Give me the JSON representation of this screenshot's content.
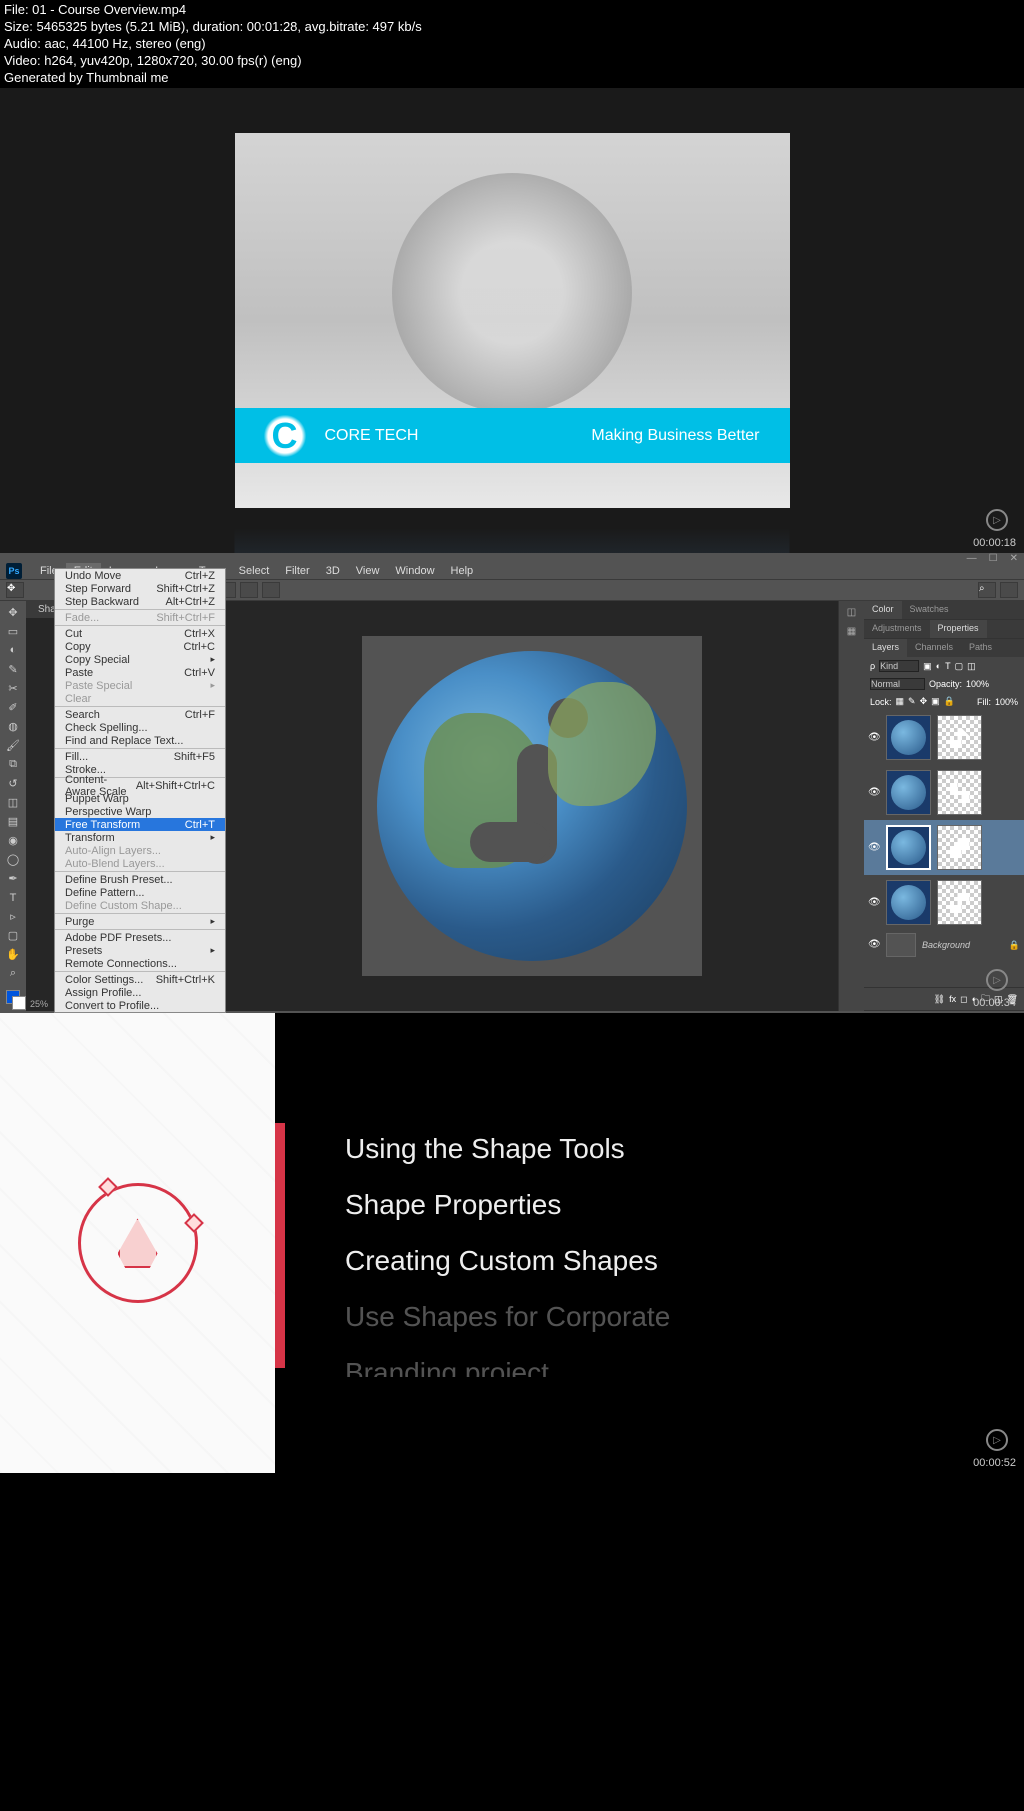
{
  "metadata": {
    "file": "File: 01 - Course Overview.mp4",
    "size": "Size: 5465325 bytes (5.21 MiB), duration: 00:01:28, avg.bitrate: 497 kb/s",
    "audio": "Audio: aac, 44100 Hz, stereo (eng)",
    "video": "Video: h264, yuv420p, 1280x720, 30.00 fps(r) (eng)",
    "generated": "Generated by Thumbnail me"
  },
  "frame1": {
    "banner_brand": "CORE TECH",
    "banner_tagline": "Making Business Better",
    "timestamp": "00:00:18"
  },
  "frame2": {
    "timestamp": "00:00:34",
    "ps_logo": "Ps",
    "window_controls": {
      "min": "—",
      "max": "☐",
      "close": "✕"
    },
    "menubar": [
      "File",
      "Edit",
      "Image",
      "Layer",
      "Type",
      "Select",
      "Filter",
      "3D",
      "View",
      "Window",
      "Help"
    ],
    "tab_label": "Shap...",
    "edit_menu": [
      {
        "label": "Undo Move",
        "shortcut": "Ctrl+Z",
        "sep": false
      },
      {
        "label": "Step Forward",
        "shortcut": "Shift+Ctrl+Z",
        "sep": false
      },
      {
        "label": "Step Backward",
        "shortcut": "Alt+Ctrl+Z",
        "sep": true
      },
      {
        "label": "Fade...",
        "shortcut": "Shift+Ctrl+F",
        "disabled": true,
        "sep": true
      },
      {
        "label": "Cut",
        "shortcut": "Ctrl+X",
        "sep": false
      },
      {
        "label": "Copy",
        "shortcut": "Ctrl+C",
        "sep": false
      },
      {
        "label": "Copy Special",
        "shortcut": "",
        "sub": true,
        "sep": false
      },
      {
        "label": "Paste",
        "shortcut": "Ctrl+V",
        "sep": false
      },
      {
        "label": "Paste Special",
        "shortcut": "",
        "sub": true,
        "disabled": true,
        "sep": false
      },
      {
        "label": "Clear",
        "shortcut": "",
        "disabled": true,
        "sep": true
      },
      {
        "label": "Search",
        "shortcut": "Ctrl+F",
        "sep": false
      },
      {
        "label": "Check Spelling...",
        "shortcut": "",
        "sep": false
      },
      {
        "label": "Find and Replace Text...",
        "shortcut": "",
        "sep": true
      },
      {
        "label": "Fill...",
        "shortcut": "Shift+F5",
        "sep": false
      },
      {
        "label": "Stroke...",
        "shortcut": "",
        "sep": true
      },
      {
        "label": "Content-Aware Scale",
        "shortcut": "Alt+Shift+Ctrl+C",
        "sep": false
      },
      {
        "label": "Puppet Warp",
        "shortcut": "",
        "sep": false
      },
      {
        "label": "Perspective Warp",
        "shortcut": "",
        "sep": false
      },
      {
        "label": "Free Transform",
        "shortcut": "Ctrl+T",
        "highlighted": true,
        "sep": false
      },
      {
        "label": "Transform",
        "shortcut": "",
        "sub": true,
        "sep": false
      },
      {
        "label": "Auto-Align Layers...",
        "shortcut": "",
        "disabled": true,
        "sep": false
      },
      {
        "label": "Auto-Blend Layers...",
        "shortcut": "",
        "disabled": true,
        "sep": true
      },
      {
        "label": "Define Brush Preset...",
        "shortcut": "",
        "sep": false
      },
      {
        "label": "Define Pattern...",
        "shortcut": "",
        "sep": false
      },
      {
        "label": "Define Custom Shape...",
        "shortcut": "",
        "disabled": true,
        "sep": true
      },
      {
        "label": "Purge",
        "shortcut": "",
        "sub": true,
        "sep": true
      },
      {
        "label": "Adobe PDF Presets...",
        "shortcut": "",
        "sep": false
      },
      {
        "label": "Presets",
        "shortcut": "",
        "sub": true,
        "sep": false
      },
      {
        "label": "Remote Connections...",
        "shortcut": "",
        "sep": true
      },
      {
        "label": "Color Settings...",
        "shortcut": "Shift+Ctrl+K",
        "sep": false
      },
      {
        "label": "Assign Profile...",
        "shortcut": "",
        "sep": false
      },
      {
        "label": "Convert to Profile...",
        "shortcut": "",
        "sep": false
      }
    ],
    "panels": {
      "top_tabs": [
        "Color",
        "Swatches"
      ],
      "mid_tabs": [
        "Adjustments",
        "Properties"
      ],
      "layers_tabs": [
        "Layers",
        "Channels",
        "Paths"
      ],
      "kind_label": "Kind",
      "blend_mode": "Normal",
      "opacity_label": "Opacity:",
      "opacity_value": "100%",
      "lock_label": "Lock:",
      "fill_label": "Fill:",
      "fill_value": "100%",
      "background_label": "Background",
      "zoom": "25%"
    }
  },
  "frame3": {
    "timestamp": "00:00:52",
    "bullets": [
      "Using the Shape Tools",
      "Shape Properties",
      "Creating Custom Shapes",
      "Use Shapes for Corporate",
      "Branding project"
    ]
  }
}
